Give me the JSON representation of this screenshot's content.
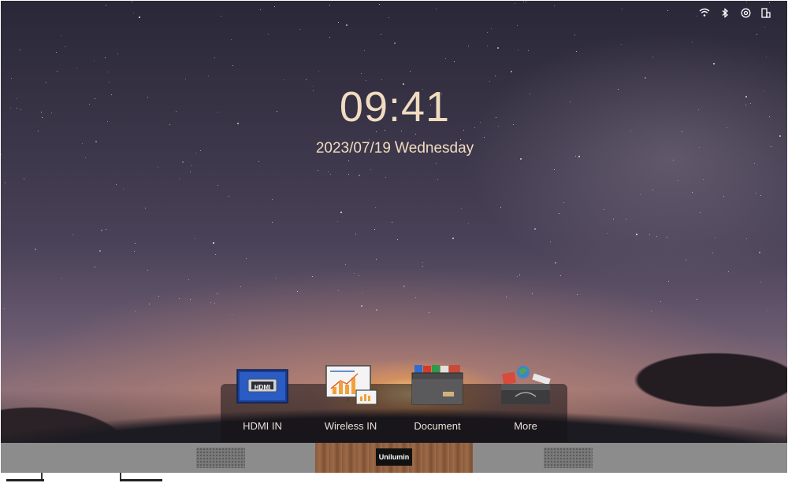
{
  "status_icons": [
    "wifi-icon",
    "bluetooth-icon",
    "hotspot-icon",
    "device-icon"
  ],
  "clock": {
    "time": "09:41",
    "date": "2023/07/19 Wednesday"
  },
  "dock": {
    "apps": [
      {
        "id": "hdmi-in",
        "label": "HDMI IN",
        "icon": "hdmi-icon",
        "icon_text": "HDMI"
      },
      {
        "id": "wireless-in",
        "label": "Wireless IN",
        "icon": "wireless-screen-icon"
      },
      {
        "id": "document",
        "label": "Document",
        "icon": "folder-icon"
      },
      {
        "id": "more",
        "label": "More",
        "icon": "toolbox-icon"
      }
    ]
  },
  "brand": {
    "logo_text": "Unilumin"
  },
  "colors": {
    "clock_text": "#f1dcc0",
    "frame_bar": "#8c8c8c"
  }
}
